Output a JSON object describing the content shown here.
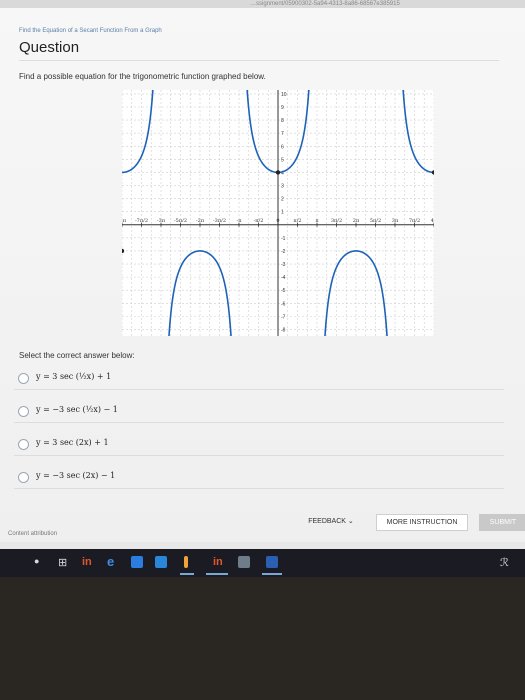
{
  "browser": {
    "url_fragment": "…ssignment/05900302-5a94-4313-8a86-68567e385915"
  },
  "breadcrumb": "Find the Equation of a Secant Function From a Graph",
  "question": {
    "title": "Question",
    "prompt": "Find a possible equation for the trigonometric function graphed below."
  },
  "graph": {
    "x_ticks": [
      "-4π",
      "-7π/2",
      "-3π",
      "-5π/2",
      "-2π",
      "-3π/2",
      "-π",
      "-π/2",
      "0",
      "π/2",
      "π",
      "3π/2",
      "2π",
      "5π/2",
      "3π",
      "7π/2",
      "4π"
    ],
    "x_tick_values": [
      -4,
      -3.5,
      -3,
      -2.5,
      -2,
      -1.5,
      -1,
      -0.5,
      0,
      0.5,
      1,
      1.5,
      2,
      2.5,
      3,
      3.5,
      4
    ],
    "y_ticks": [
      "-8",
      "-7",
      "-6",
      "-5",
      "-4",
      "-3",
      "-2",
      "-1",
      "1",
      "2",
      "3",
      "4",
      "5",
      "6",
      "7",
      "8",
      "9",
      "10"
    ],
    "y_tick_values": [
      -8,
      -7,
      -6,
      -5,
      -4,
      -3,
      -2,
      -1,
      1,
      2,
      3,
      4,
      5,
      6,
      7,
      8,
      9,
      10
    ],
    "x_range_pi_units": [
      -4,
      4
    ],
    "y_range": [
      -8.5,
      10.3
    ],
    "function": {
      "type": "secant",
      "a": 3,
      "b": 0.5,
      "d": 1
    },
    "curve_color": "#1d63b8",
    "vertex_points": [
      [
        -4,
        -2
      ],
      [
        0,
        4
      ],
      [
        4,
        4
      ]
    ],
    "vertex_point_units": "x in multiples of π"
  },
  "answers": {
    "label": "Select the correct answer below:",
    "options": [
      {
        "text": "y = 3 sec (½x) + 1"
      },
      {
        "text": "y = −3 sec (½x) − 1"
      },
      {
        "text": "y = 3 sec (2x) + 1"
      },
      {
        "text": "y = −3 sec (2x) − 1"
      }
    ]
  },
  "buttons": {
    "feedback": "FEEDBACK ⌄",
    "more": "MORE INSTRUCTION",
    "submit": "SUBMIT"
  },
  "attribution": "Content attribution",
  "taskbar": {
    "apps": [
      "mic",
      "windows",
      "linkedin",
      "edge",
      "store",
      "explorer",
      "camera",
      "linkedin-2",
      "photos",
      "word"
    ],
    "linkedin_label": "in",
    "linkedin2_label": "in",
    "tray": "ℛ"
  }
}
